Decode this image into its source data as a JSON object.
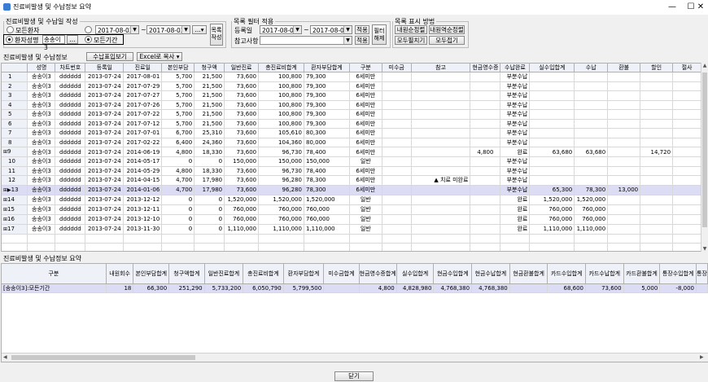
{
  "window": {
    "title": "진료비발생 및 수납정보 요약",
    "minimize": "—",
    "maximize": "☐",
    "close": "✕"
  },
  "filter_top": {
    "legend": "진료비발생 및 수납일 작성",
    "all_patients": "모든환자",
    "patient_choice": "환자성명",
    "patient_name": "송송이3",
    "browse": "...",
    "all_period": "모든기간",
    "date_from": "2017-08-02",
    "tilde": "~",
    "date_to": "2017-08-02",
    "dots": "...",
    "list_btn": "목록 작성"
  },
  "list_filter": {
    "legend": "목록 필터 적용",
    "reg_label": "등록일",
    "reg_from": "2017-08-02",
    "tilde": "~",
    "reg_to": "2017-08-02",
    "apply1": "적용",
    "ref_label": "참고사항",
    "apply2": "적용",
    "clear_btn": "필터 해제"
  },
  "display": {
    "legend": "목록 표시 방법",
    "asc": "내원순정렬",
    "desc": "내원역순정렬",
    "expand": "모두펼치기",
    "collapse": "모두접기"
  },
  "grid_bar": {
    "label": "진료비발생 및 수납정보",
    "view_btn": "수납표입보기",
    "excel_btn": "Excel로 복사"
  },
  "columns": [
    "",
    "성명",
    "차트번호",
    "등록일",
    "진료일",
    "본인부담",
    "청구액",
    "일반진료",
    "총진료비합계",
    "환자부담합계",
    "구분",
    "미수금",
    "참고",
    "현금영수증",
    "수납완료",
    "실수입합계",
    "수납",
    "환불",
    "할인",
    "절사"
  ],
  "rows": [
    {
      "n": "1",
      "c": [
        "송송이3",
        "dddddd",
        "2013-07-24",
        "2017-08-01",
        "5,700",
        "21,500",
        "73,600",
        "100,800",
        "79,300",
        "6세미만",
        "",
        "",
        "",
        "부분수납",
        "",
        "",
        "",
        "",
        ""
      ]
    },
    {
      "n": "2",
      "c": [
        "송송이3",
        "dddddd",
        "2013-07-24",
        "2017-07-29",
        "5,700",
        "21,500",
        "73,600",
        "100,800",
        "79,300",
        "6세미만",
        "",
        "",
        "",
        "부분수납",
        "",
        "",
        "",
        "",
        ""
      ]
    },
    {
      "n": "3",
      "c": [
        "송송이3",
        "dddddd",
        "2013-07-24",
        "2017-07-27",
        "5,700",
        "21,500",
        "73,600",
        "100,800",
        "79,300",
        "6세미만",
        "",
        "",
        "",
        "부분수납",
        "",
        "",
        "",
        "",
        ""
      ]
    },
    {
      "n": "4",
      "c": [
        "송송이3",
        "dddddd",
        "2013-07-24",
        "2017-07-26",
        "5,700",
        "21,500",
        "73,600",
        "100,800",
        "79,300",
        "6세미만",
        "",
        "",
        "",
        "부분수납",
        "",
        "",
        "",
        "",
        ""
      ]
    },
    {
      "n": "5",
      "c": [
        "송송이3",
        "dddddd",
        "2013-07-24",
        "2017-07-22",
        "5,700",
        "21,500",
        "73,600",
        "100,800",
        "79,300",
        "6세미만",
        "",
        "",
        "",
        "부분수납",
        "",
        "",
        "",
        "",
        ""
      ]
    },
    {
      "n": "6",
      "c": [
        "송송이3",
        "dddddd",
        "2013-07-24",
        "2017-07-12",
        "5,700",
        "21,500",
        "73,600",
        "100,800",
        "79,300",
        "6세미만",
        "",
        "",
        "",
        "부분수납",
        "",
        "",
        "",
        "",
        ""
      ]
    },
    {
      "n": "7",
      "c": [
        "송송이3",
        "dddddd",
        "2013-07-24",
        "2017-07-01",
        "6,700",
        "25,310",
        "73,600",
        "105,610",
        "80,300",
        "6세미만",
        "",
        "",
        "",
        "부분수납",
        "",
        "",
        "",
        "",
        ""
      ]
    },
    {
      "n": "8",
      "c": [
        "송송이3",
        "dddddd",
        "2013-07-24",
        "2017-02-22",
        "6,400",
        "24,360",
        "73,600",
        "104,360",
        "80,000",
        "6세미만",
        "",
        "",
        "",
        "부분수납",
        "",
        "",
        "",
        "",
        ""
      ]
    },
    {
      "n": "9",
      "c": [
        "송송이3",
        "dddddd",
        "2013-07-24",
        "2014-06-19",
        "4,800",
        "18,330",
        "73,600",
        "96,730",
        "78,400",
        "6세미만",
        "",
        "",
        "4,800",
        "완료",
        "63,680",
        "63,680",
        "",
        "14,720",
        ""
      ]
    },
    {
      "n": "10",
      "c": [
        "송송이3",
        "dddddd",
        "2013-07-24",
        "2014-05-17",
        "0",
        "0",
        "150,000",
        "150,000",
        "150,000",
        "일반",
        "",
        "",
        "",
        "부분수납",
        "",
        "",
        "",
        "",
        ""
      ]
    },
    {
      "n": "11",
      "c": [
        "송송이3",
        "dddddd",
        "2013-07-24",
        "2014-05-29",
        "4,800",
        "18,330",
        "73,600",
        "96,730",
        "78,400",
        "6세미만",
        "",
        "",
        "",
        "부분수납",
        "",
        "",
        "",
        "",
        ""
      ]
    },
    {
      "n": "12",
      "c": [
        "송송이3",
        "dddddd",
        "2013-07-24",
        "2014-04-15",
        "4,700",
        "17,980",
        "73,600",
        "96,280",
        "78,300",
        "6세미만",
        "",
        "▲ 치료 미완료",
        "",
        "부분수납",
        "",
        "",
        "",
        "",
        ""
      ]
    },
    {
      "n": "13",
      "c": [
        "송송이3",
        "dddddd",
        "2013-07-24",
        "2014-01-06",
        "4,700",
        "17,980",
        "73,600",
        "96,280",
        "78,300",
        "6세미만",
        "",
        "",
        "",
        "부분수납",
        "65,300",
        "78,300",
        "13,000",
        "",
        ""
      ]
    },
    {
      "n": "14",
      "c": [
        "송송이3",
        "dddddd",
        "2013-07-24",
        "2013-12-12",
        "0",
        "0",
        "1,520,000",
        "1,520,000",
        "1,520,000",
        "일반",
        "",
        "",
        "",
        "완료",
        "1,520,000",
        "1,520,000",
        "",
        "",
        ""
      ]
    },
    {
      "n": "15",
      "c": [
        "송송이3",
        "dddddd",
        "2013-07-24",
        "2013-12-11",
        "0",
        "0",
        "760,000",
        "760,000",
        "760,000",
        "일반",
        "",
        "",
        "",
        "완료",
        "760,000",
        "760,000",
        "",
        "",
        ""
      ]
    },
    {
      "n": "16",
      "c": [
        "송송이3",
        "dddddd",
        "2013-07-24",
        "2013-12-10",
        "0",
        "0",
        "760,000",
        "760,000",
        "760,000",
        "일반",
        "",
        "",
        "",
        "완료",
        "760,000",
        "760,000",
        "",
        "",
        ""
      ]
    },
    {
      "n": "17",
      "c": [
        "송송이3",
        "dddddd",
        "2013-07-24",
        "2013-11-30",
        "0",
        "0",
        "1,110,000",
        "1,110,000",
        "1,110,000",
        "일반",
        "",
        "",
        "",
        "완료",
        "1,110,000",
        "1,110,000",
        "",
        "",
        ""
      ]
    }
  ],
  "summary": {
    "title": "진료비발생 및 수납정보 요약",
    "columns": [
      "구분",
      "내원회수",
      "본인부담합계",
      "청구액합계",
      "일반진료합계",
      "총진료비합계",
      "환자부담합계",
      "미수금합계",
      "현금영수증합계",
      "실수입합계",
      "현금수입합계",
      "현금수납합계",
      "현금환불합계",
      "카드수입합계",
      "카드수납합계",
      "카드환불합계",
      "통장수입합계",
      "통장"
    ],
    "row": [
      "[송송이3]:모든기간",
      "18",
      "66,300",
      "251,290",
      "5,733,200",
      "6,050,790",
      "5,799,500",
      "",
      "4,800",
      "4,828,980",
      "4,768,380",
      "4,768,380",
      "",
      "68,600",
      "73,600",
      "5,000",
      "-8,000",
      ""
    ]
  },
  "close_btn": "닫기"
}
